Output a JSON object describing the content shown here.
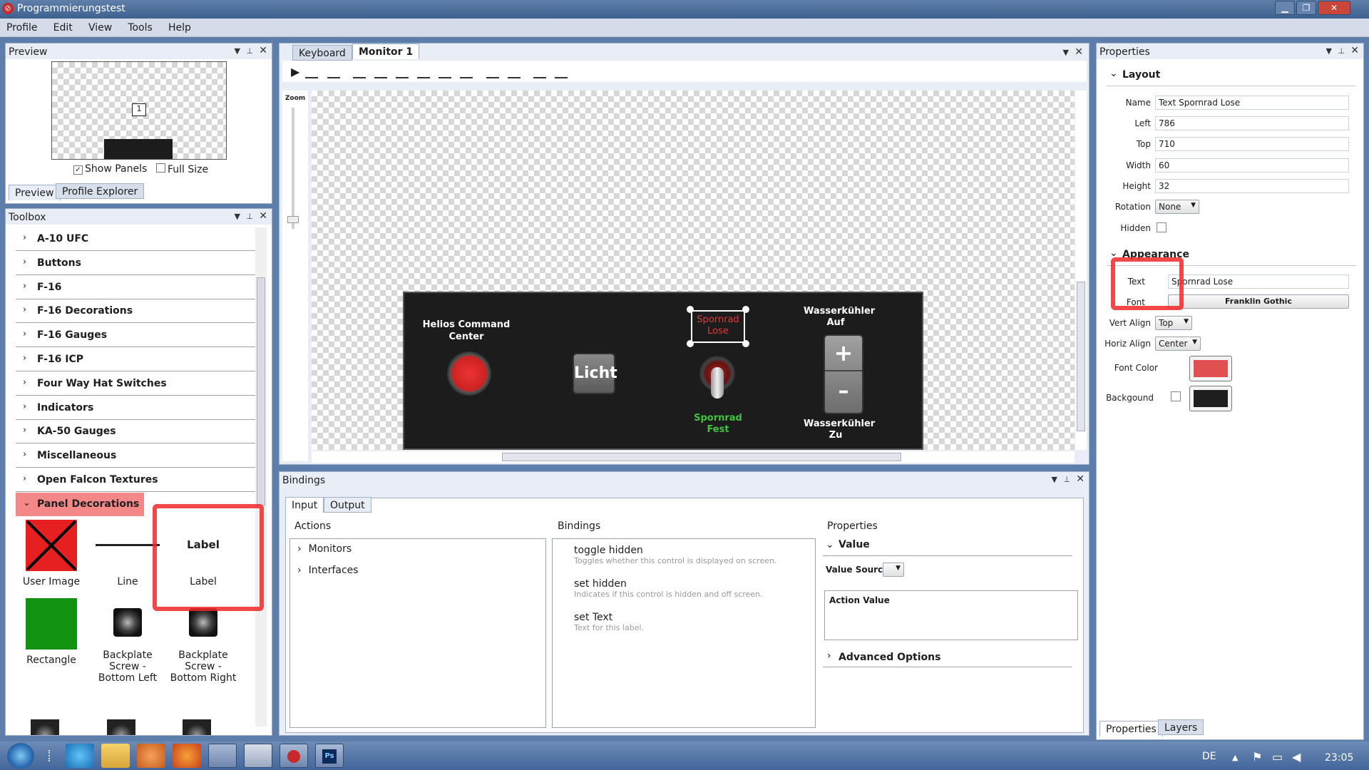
{
  "window": {
    "title": "Programmierungstest",
    "controls": [
      "▁",
      "❐",
      "✕"
    ]
  },
  "menu": [
    "Profile",
    "Edit",
    "View",
    "Tools",
    "Help"
  ],
  "preview": {
    "title": "Preview",
    "preview_badge": "1",
    "show_panels": "Show Panels",
    "full_size": "Full Size",
    "tabs": [
      "Preview",
      "Profile Explorer"
    ]
  },
  "toolbox": {
    "title": "Toolbox",
    "categories": [
      "A-10 UFC",
      "Buttons",
      "F-16",
      "F-16 Decorations",
      "F-16 Gauges",
      "F-16 ICP",
      "Four Way Hat Switches",
      "Indicators",
      "KA-50 Gauges",
      "Miscellaneous",
      "Open Falcon Textures",
      "Panel Decorations"
    ],
    "items": [
      {
        "label": "User Image"
      },
      {
        "label": "Line"
      },
      {
        "label": "Label",
        "glyph": "Label"
      },
      {
        "label": "Rectangle"
      },
      {
        "label": "Backplate Screw - Bottom Left"
      },
      {
        "label": "Backplate Screw - Bottom Right"
      }
    ]
  },
  "editor": {
    "tabs": [
      "Keyboard",
      "Monitor 1"
    ],
    "zoom_label": "Zoom",
    "panel": {
      "helios_label": "Helios Command Center",
      "licht": "Licht",
      "sporrad_lose": "Spornrad Lose",
      "sporrad_fest": "Spornrad Fest",
      "wasser_auf": "Wasserkühler Auf",
      "wasser_zu": "Wasserkühler Zu",
      "plus": "+",
      "minus": "–"
    }
  },
  "bindings": {
    "title": "Bindings",
    "tabs": [
      "Input",
      "Output"
    ],
    "actions_header": "Actions",
    "actions": [
      "Monitors",
      "Interfaces"
    ],
    "bindings_header": "Bindings",
    "list": [
      {
        "name": "toggle hidden",
        "desc": "Toggles whether this control is displayed on screen."
      },
      {
        "name": "set hidden",
        "desc": "Indicates if this control is hidden and off screen."
      },
      {
        "name": "set Text",
        "desc": "Text for this label."
      }
    ],
    "props_header": "Properties",
    "value_section": "Value",
    "value_source": "Value Source",
    "action_value": "Action Value",
    "advanced": "Advanced Options"
  },
  "properties": {
    "title": "Properties",
    "layout_header": "Layout",
    "name_label": "Name",
    "name": "Text Spornrad Lose",
    "left_label": "Left",
    "left": "786",
    "top_label": "Top",
    "top": "710",
    "width_label": "Width",
    "width": "60",
    "height_label": "Height",
    "height": "32",
    "rotation_label": "Rotation",
    "rotation": "None",
    "hidden_label": "Hidden",
    "appearance_header": "Appearance",
    "text_label": "Text",
    "text": "Spornrad Lose",
    "font_label": "Font",
    "font": "Franklin Gothic",
    "valign_label": "Vert Align",
    "valign": "Top",
    "halign_label": "Horiz Align",
    "halign": "Center",
    "fontcolor_label": "Font Color",
    "font_color": "#e05050",
    "background_label": "Backgound",
    "background_color": "#1e1e1e",
    "bottom_tabs": [
      "Properties",
      "Layers"
    ]
  },
  "taskbar": {
    "lang": "DE",
    "time": "23:05"
  },
  "colors": {
    "accent_highlight": "#e05050",
    "panel_bg": "#1c1c1c",
    "green_text": "#3ec43e"
  }
}
